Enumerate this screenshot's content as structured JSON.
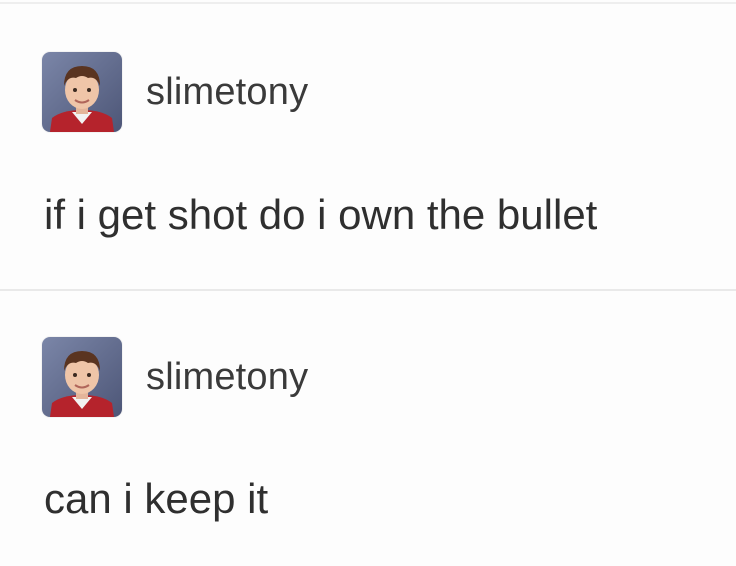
{
  "posts": [
    {
      "username": "slimetony",
      "text": "if i get shot do i own the bullet",
      "avatar_icon": "child-portrait-avatar"
    },
    {
      "username": "slimetony",
      "text": "can i keep it",
      "avatar_icon": "child-portrait-avatar"
    }
  ],
  "colors": {
    "background": "#fdfdfd",
    "divider": "#e9e9e9",
    "username": "#3a3a3a",
    "text": "#2f2f2f"
  }
}
